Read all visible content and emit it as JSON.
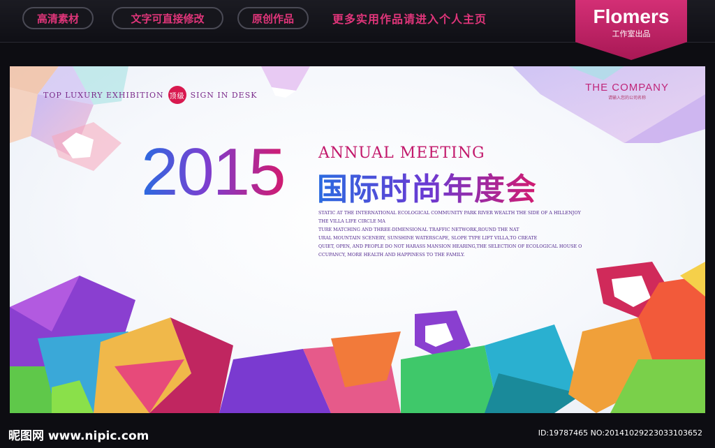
{
  "topbar": {
    "pills": [
      "高清素材",
      "文字可直接修改",
      "原创作品"
    ],
    "promo": "更多实用作品请进入个人主页"
  },
  "brand": {
    "name": "Flomers",
    "subtitle": "工作室出品"
  },
  "poster": {
    "tagline_left": "TOP LUXURY EXHIBITION",
    "badge": "顶级",
    "tagline_right": "SIGN IN DESK",
    "company_name": "THE COMPANY",
    "company_sub": "请输入您的公司名称",
    "year": "2015",
    "annual": "ANNUAL  MEETING",
    "cn_title": "国际时尚年度会",
    "body_lines": [
      "STATIC AT THE INTERNATIONAL ECOLOGICAL COMMUNITY PARK RIVER WEALTH THE SIDE OF A HILLENJOY",
      "THE VILLA LIFE CIRCLE MA",
      "TURE MATCHING AND THREE-DIMENSIONAL TRAFFIC NETWORK,ROUND THE NAT",
      "URAL MOUNTAIN SCENERY, SUNSHINE WATERSCAPE, SLOPE TYPE LIFT VILLA,TO CREATE",
      "QUIET, OPEN, AND PEOPLE DO NOT HARASS MANSION HEARING,THE SELECTION OF ECOLOGICAL HOUSE O",
      "CCUPANCY, MORE HEALTH AND HAPPINESS TO THE FAMILY."
    ]
  },
  "footer": {
    "watermark_left": "昵图网 www.nipic.com",
    "watermark_right": "ID:19787465 NO:20141029223033103652"
  },
  "colors": {
    "accent": "#e0357a",
    "brand_bg": "#c02266",
    "blue": "#2a6be0",
    "purple": "#7b3fd0",
    "magenta": "#d21a6f"
  }
}
